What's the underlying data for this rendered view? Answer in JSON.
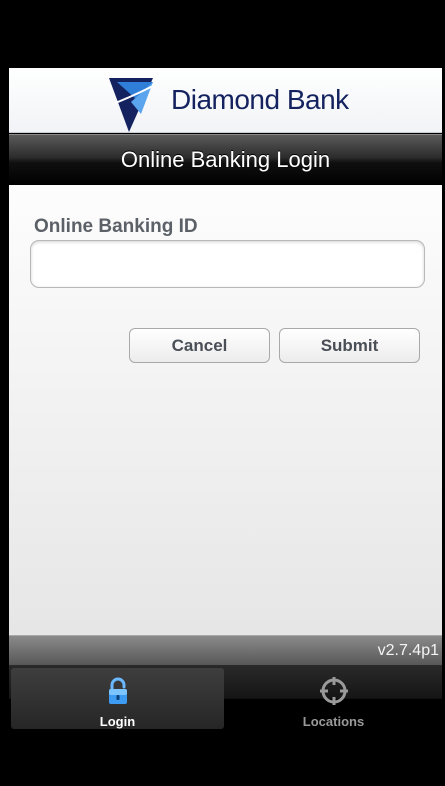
{
  "brand": {
    "name": "Diamond Bank",
    "logo_icon": "diamond-logo-icon",
    "colors": {
      "navy": "#14225f",
      "blue": "#2f7fd8"
    }
  },
  "header": {
    "title": "Online Banking Login"
  },
  "form": {
    "id_label": "Online Banking ID",
    "id_value": "",
    "id_placeholder": "",
    "cancel_label": "Cancel",
    "submit_label": "Submit"
  },
  "footer": {
    "version": "v2.7.4p1"
  },
  "tabs": [
    {
      "label": "Login",
      "icon": "lock-icon",
      "active": true
    },
    {
      "label": "Locations",
      "icon": "crosshair-icon",
      "active": false
    }
  ]
}
